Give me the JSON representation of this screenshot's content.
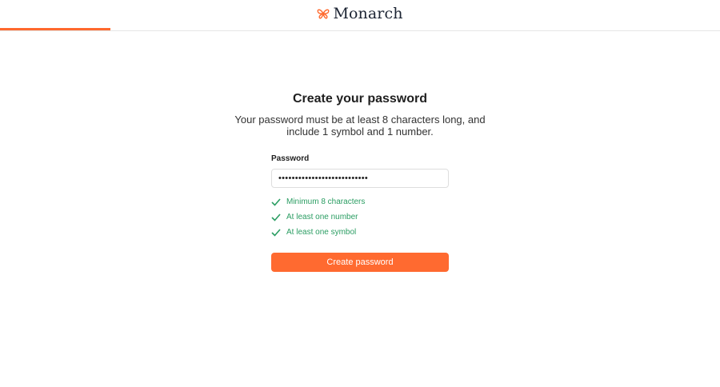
{
  "header": {
    "logo_text": "Monarch",
    "logo_icon": "butterfly-icon",
    "brand_color": "#ff692d",
    "progress_fraction": 0.153
  },
  "form": {
    "title": "Create your password",
    "subtitle": "Your password must be at least 8 characters long, and include 1 symbol and 1 number.",
    "password_label": "Password",
    "password_value": "•••••••••••••••••••••••••••",
    "rules": [
      {
        "label": "Minimum 8 characters",
        "met": true
      },
      {
        "label": "At least one number",
        "met": true
      },
      {
        "label": "At least one symbol",
        "met": true
      }
    ],
    "rule_met_color": "#2a9d62",
    "submit_label": "Create password"
  }
}
